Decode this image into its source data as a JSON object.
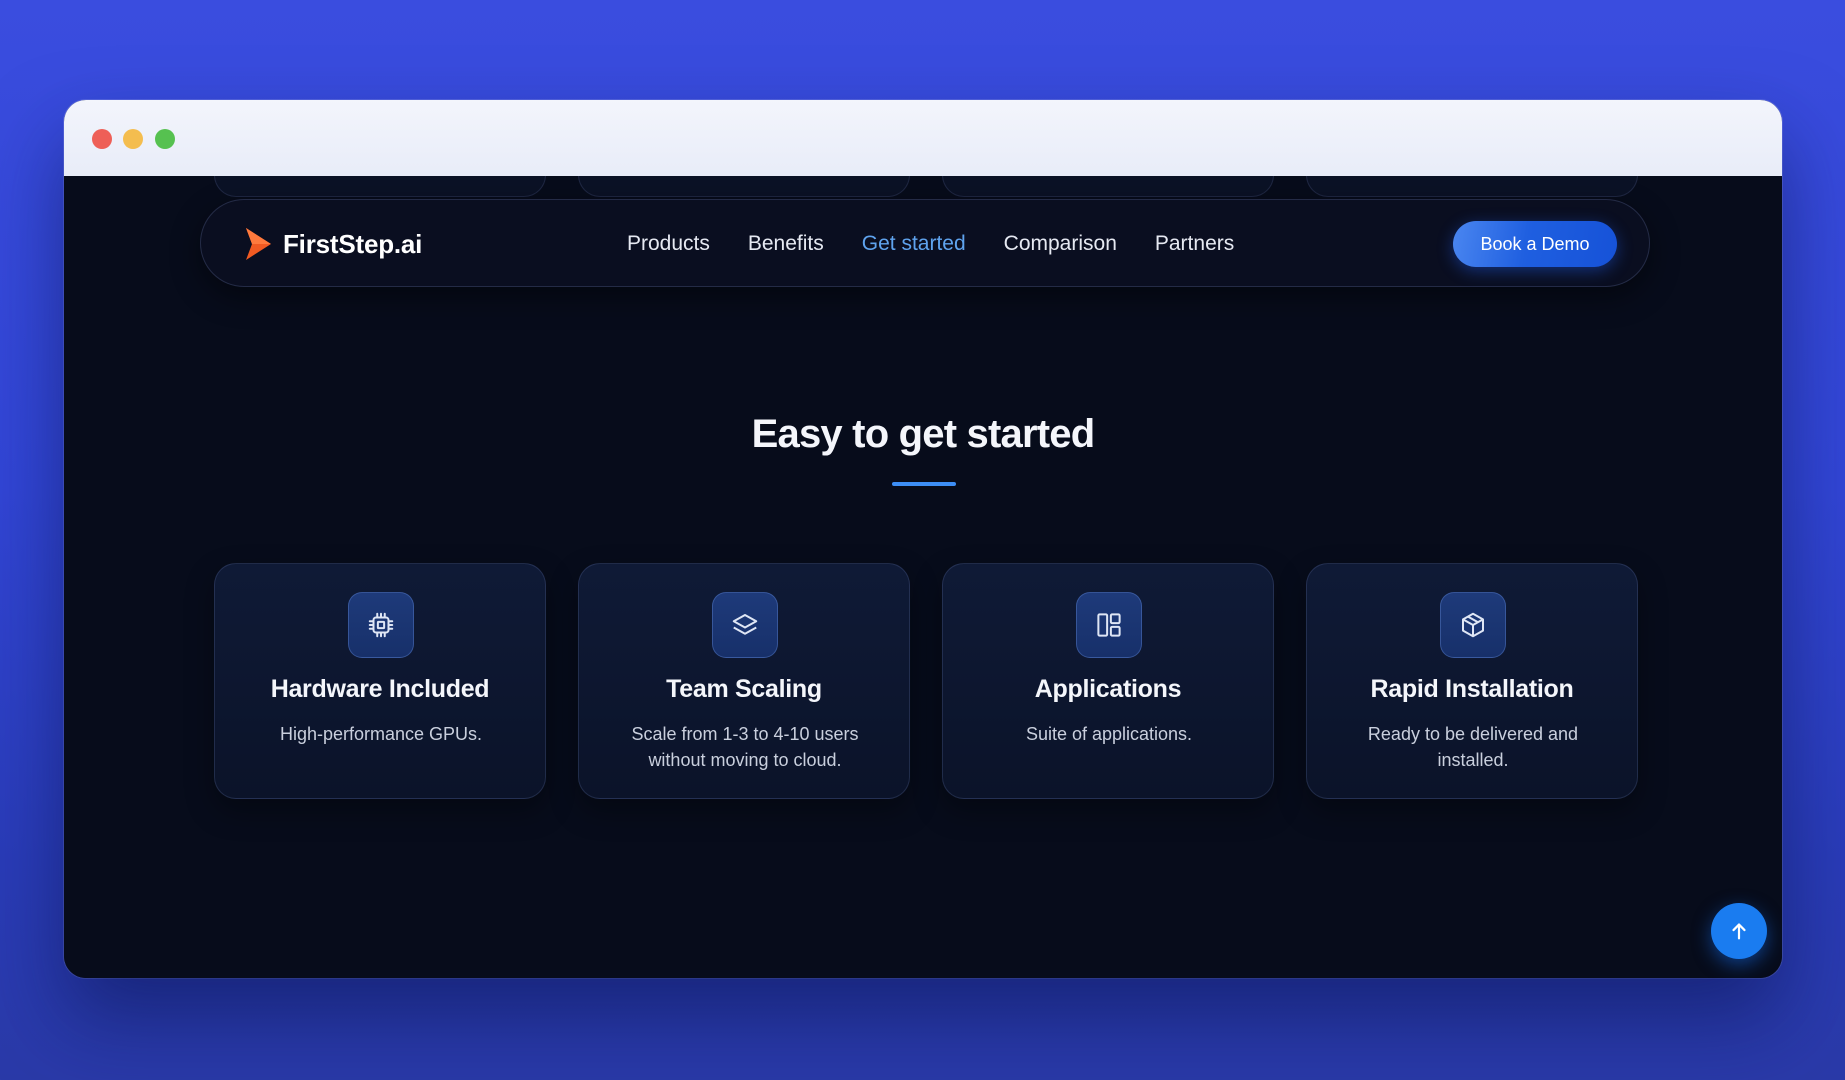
{
  "brand": {
    "name": "FirstStep.ai",
    "logo_icon": "arrow-play-icon",
    "logo_color": "#f15a22"
  },
  "nav": {
    "links": [
      {
        "label": "Products",
        "active": false
      },
      {
        "label": "Benefits",
        "active": false
      },
      {
        "label": "Get started",
        "active": true
      },
      {
        "label": "Comparison",
        "active": false
      },
      {
        "label": "Partners",
        "active": false
      }
    ],
    "cta_label": "Book a Demo"
  },
  "section": {
    "title": "Easy to get started",
    "accent_color": "#3d8ef5"
  },
  "cards": [
    {
      "icon": "cpu-chip-icon",
      "title": "Hardware Included",
      "description": "High-performance GPUs."
    },
    {
      "icon": "layers-icon",
      "title": "Team Scaling",
      "description": "Scale from 1-3 to 4-10 users without moving to cloud."
    },
    {
      "icon": "layout-panels-icon",
      "title": "Applications",
      "description": "Suite of applications."
    },
    {
      "icon": "package-box-icon",
      "title": "Rapid Installation",
      "description": "Ready to be delivered and installed."
    }
  ],
  "scroll_top": {
    "icon": "arrow-up-icon"
  },
  "colors": {
    "page_bg": "#070c1b",
    "primary_blue": "#1a7cf0",
    "active_link": "#5fa3ee"
  }
}
